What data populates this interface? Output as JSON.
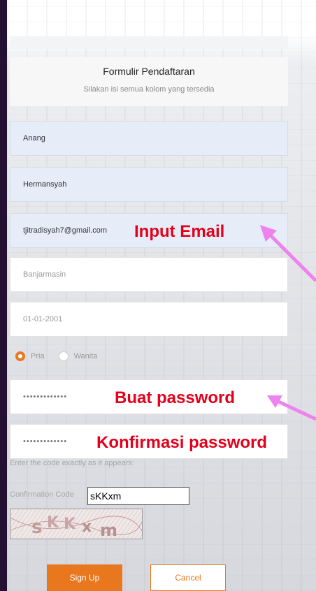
{
  "form": {
    "title": "Formulir Pendaftaran",
    "subtitle": "Silakan isi semua kolom yang tersedia",
    "first_name": "Anang",
    "last_name": "Hermansyah",
    "email": "tjitradisyah7@gmail.com",
    "city_placeholder": "Banjarmasin",
    "birthdate_placeholder": "01-01-2001",
    "gender": {
      "selected": "Pria",
      "options": [
        "Pria",
        "Wanita"
      ]
    },
    "password_mask": "•••••••••••••",
    "confirm_password_mask": "•••••••••••••",
    "captcha": {
      "instruction": "Enter the code exactly as it appears:",
      "label": "Confirmation Code",
      "value": "sKKxm",
      "image_text": "sKKxm"
    },
    "buttons": {
      "signup": "Sign Up",
      "cancel": "Cancel"
    }
  },
  "annotations": {
    "email": "Input Email",
    "password": "Buat password",
    "confirm": "Konfirmasi password"
  },
  "colors": {
    "accent": "#e8771e",
    "annotation_text": "#e4001b",
    "annotation_arrow": "#ee82ee",
    "filled_field": "#e6edf9"
  }
}
